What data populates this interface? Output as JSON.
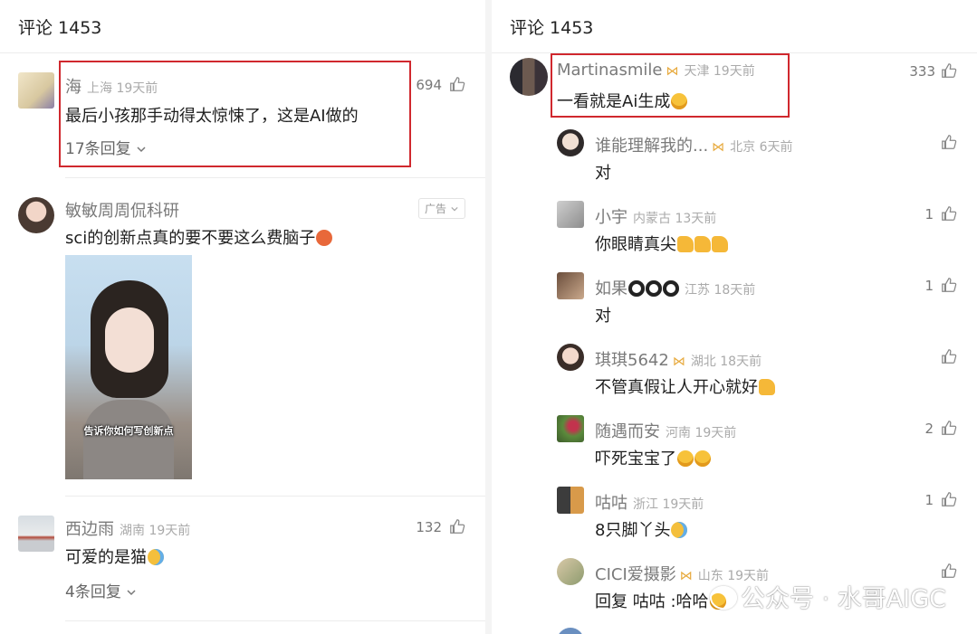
{
  "left": {
    "header": "评论 1453",
    "comments": [
      {
        "name": "海",
        "meta": "上海 19天前",
        "text": "最后小孩那手动得太惊悚了，这是AI做的",
        "likes": "694",
        "replies": "17条回复"
      },
      {
        "name": "敏敏周周侃科研",
        "ad": "广告",
        "text": "sci的创新点真的要不要这么费脑子",
        "caption": "告诉你如何写创新点"
      },
      {
        "name": "西边雨",
        "meta": "湖南 19天前",
        "text": "可爱的是猫",
        "likes": "132",
        "replies": "4条回复"
      }
    ]
  },
  "right": {
    "header": "评论 1453",
    "main": {
      "name": "Martinasmile",
      "meta": "天津 19天前",
      "text": "一看就是Ai生成",
      "likes": "333"
    },
    "replies": [
      {
        "name": "谁能理解我的...",
        "meta": "北京 6天前",
        "text": "对",
        "likes": ""
      },
      {
        "name": "小宇",
        "meta": "内蒙古 13天前",
        "text": "你眼睛真尖",
        "likes": "1"
      },
      {
        "name": "如果",
        "meta": "江苏 18天前",
        "text": "对",
        "likes": "1"
      },
      {
        "name": "琪琪5642",
        "meta": "湖北 18天前",
        "text": "不管真假让人开心就好",
        "likes": ""
      },
      {
        "name": "随遇而安",
        "meta": "河南 19天前",
        "text": "吓死宝宝了",
        "likes": "2"
      },
      {
        "name": "咕咕",
        "meta": "浙江 19天前",
        "text": "8只脚丫头",
        "likes": "1"
      },
      {
        "name": "CICI爱摄影",
        "meta": "山东 19天前",
        "text": "回复 咕咕 :哈哈",
        "likes": ""
      }
    ]
  },
  "watermark": "公众号 · 水哥AIGC",
  "colors": {
    "highlight_box": "#d0282e",
    "vip_badge": "#e7a93c",
    "meta_text": "#aaaaaa"
  },
  "icons": [
    "thumbs-up-icon",
    "chevron-down-icon",
    "vip-badge-icon",
    "grin-emoji",
    "thumbs-emoji",
    "cry-laugh-emoji",
    "angry-emoji",
    "eight-ball-emoji"
  ]
}
